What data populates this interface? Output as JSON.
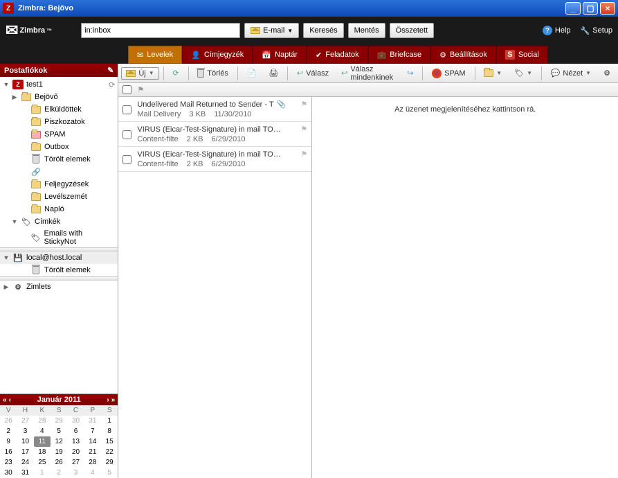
{
  "window": {
    "title": "Zimbra: Bejövo"
  },
  "brand": "Zimbra",
  "search": {
    "value": "in:inbox",
    "scope": "E-mail",
    "go": "Keresés",
    "save": "Mentés",
    "advanced": "Összetett"
  },
  "topright": {
    "help": "Help",
    "setup": "Setup"
  },
  "tabs": [
    {
      "label": "Levelek",
      "active": true
    },
    {
      "label": "Címjegyzék"
    },
    {
      "label": "Naptár"
    },
    {
      "label": "Feladatok"
    },
    {
      "label": "Briefcase"
    },
    {
      "label": "Beállítások"
    },
    {
      "label": "Social"
    }
  ],
  "sidebar": {
    "header": "Postafiókok",
    "account": "test1",
    "folders": {
      "inbox": "Bejövő",
      "sent": "Elküldöttek",
      "drafts": "Piszkozatok",
      "spam": "SPAM",
      "outbox": "Outbox",
      "trash": "Törölt elemek",
      "notes": "Feljegyzések",
      "junk": "Levélszemét",
      "log": "Napló"
    },
    "tags_label": "Címkék",
    "tag1": "Emails with StickyNot",
    "account2": "local@host.local",
    "trash2": "Törölt elemek",
    "zimlets": "Zimlets"
  },
  "calendar": {
    "title": "Január 2011",
    "dow": [
      "V",
      "H",
      "K",
      "S",
      "C",
      "P",
      "S"
    ],
    "weeks": [
      [
        {
          "d": 26,
          "o": true
        },
        {
          "d": 27,
          "o": true
        },
        {
          "d": 28,
          "o": true
        },
        {
          "d": 29,
          "o": true
        },
        {
          "d": 30,
          "o": true
        },
        {
          "d": 31,
          "o": true
        },
        {
          "d": 1
        }
      ],
      [
        {
          "d": 2
        },
        {
          "d": 3
        },
        {
          "d": 4
        },
        {
          "d": 5
        },
        {
          "d": 6
        },
        {
          "d": 7
        },
        {
          "d": 8
        }
      ],
      [
        {
          "d": 9
        },
        {
          "d": 10
        },
        {
          "d": 11,
          "today": true
        },
        {
          "d": 12
        },
        {
          "d": 13
        },
        {
          "d": 14
        },
        {
          "d": 15
        }
      ],
      [
        {
          "d": 16
        },
        {
          "d": 17
        },
        {
          "d": 18
        },
        {
          "d": 19
        },
        {
          "d": 20
        },
        {
          "d": 21
        },
        {
          "d": 22
        }
      ],
      [
        {
          "d": 23
        },
        {
          "d": 24
        },
        {
          "d": 25
        },
        {
          "d": 26
        },
        {
          "d": 27
        },
        {
          "d": 28
        },
        {
          "d": 29
        }
      ],
      [
        {
          "d": 30
        },
        {
          "d": 31
        },
        {
          "d": 1,
          "o": true
        },
        {
          "d": 2,
          "o": true
        },
        {
          "d": 3,
          "o": true
        },
        {
          "d": 4,
          "o": true
        },
        {
          "d": 5,
          "o": true
        }
      ]
    ]
  },
  "toolbar": {
    "new": "Új",
    "delete": "Törlés",
    "reply": "Válasz",
    "reply_all": "Válasz mindenkinek",
    "spam": "SPAM",
    "view": "Nézet"
  },
  "messages": [
    {
      "subject": "Undelivered Mail Returned to Sender - T",
      "from": "Mail Delivery",
      "size": "3 KB",
      "date": "11/30/2010",
      "attach": true
    },
    {
      "subject": "VIRUS (Eicar-Test-Signature) in mail TO YOU",
      "from": "Content-filte",
      "size": "2 KB",
      "date": "6/29/2010",
      "attach": false
    },
    {
      "subject": "VIRUS (Eicar-Test-Signature) in mail TO YOU",
      "from": "Content-filte",
      "size": "2 KB",
      "date": "6/29/2010",
      "attach": false
    }
  ],
  "preview": {
    "placeholder": "Az üzenet megjelenítéséhez kattintson rá."
  }
}
